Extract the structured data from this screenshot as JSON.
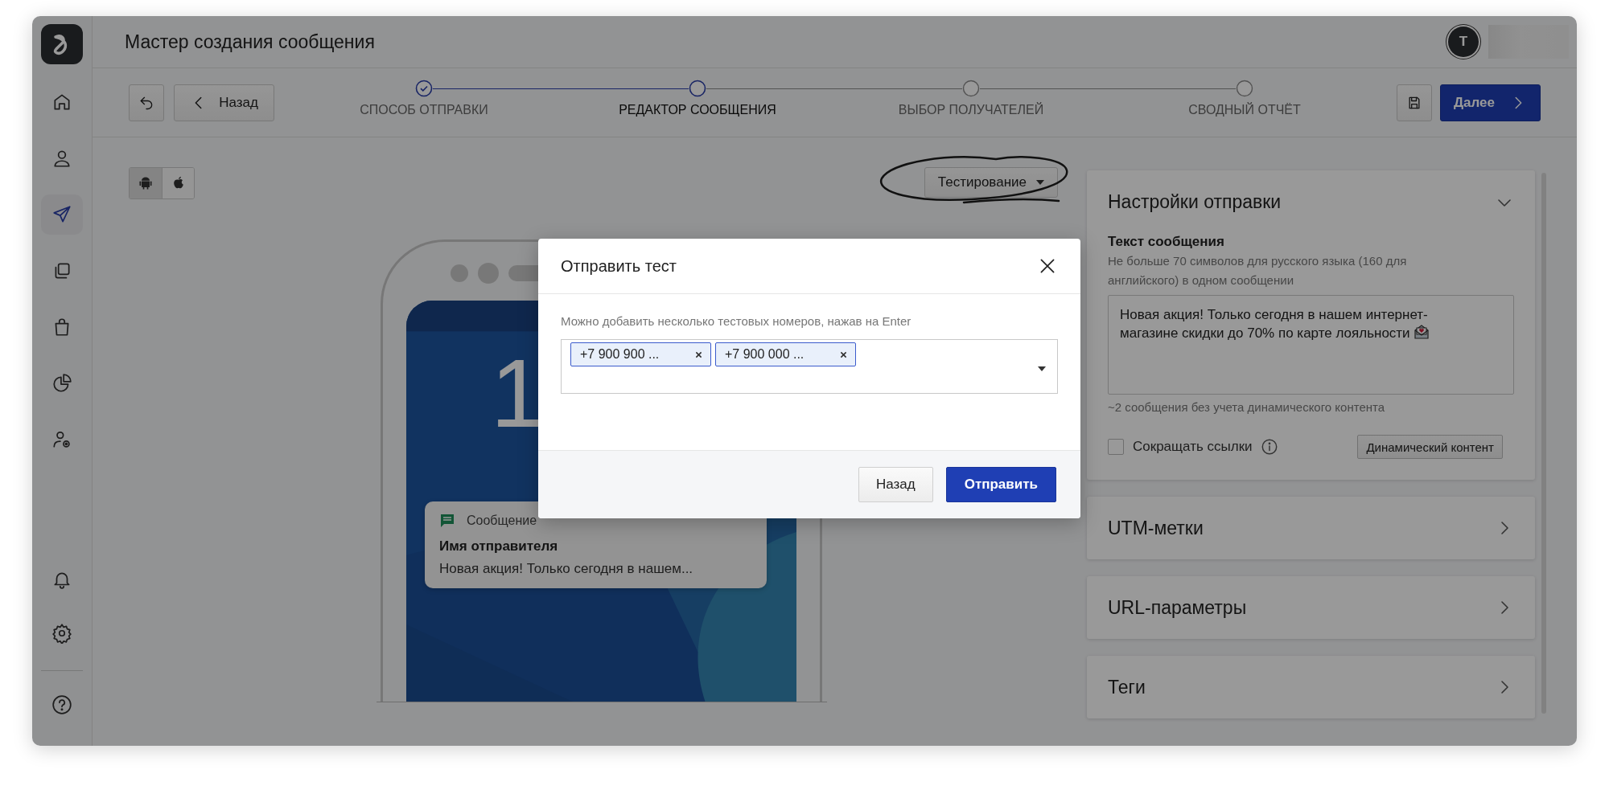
{
  "header": {
    "title": "Мастер создания сообщения",
    "avatar_initial": "T"
  },
  "sidebar": {
    "items": [
      {
        "kind": "home",
        "selected": false
      },
      {
        "kind": "user",
        "selected": false
      },
      {
        "kind": "send",
        "selected": true
      },
      {
        "kind": "copy",
        "selected": false
      },
      {
        "kind": "bag",
        "selected": false
      },
      {
        "kind": "pie",
        "selected": false
      },
      {
        "kind": "user-gear",
        "selected": false
      }
    ],
    "bottom_items": [
      {
        "kind": "bell",
        "selected": false
      },
      {
        "kind": "gear",
        "selected": false
      },
      {
        "kind": "help",
        "selected": false
      }
    ]
  },
  "toolbar": {
    "back_label": "Назад",
    "next_label": "Далее",
    "steps": [
      {
        "label": "СПОСОБ ОТПРАВКИ",
        "completed": true,
        "selected": false
      },
      {
        "label": "РЕДАКТОР СООБЩЕНИЯ",
        "completed": false,
        "selected": true
      },
      {
        "label": "ВЫБОР ПОЛУЧАТЕЛЕЙ",
        "completed": false,
        "selected": false
      },
      {
        "label": "СВОДНЫЙ ОТЧЁТ",
        "completed": false,
        "selected": false
      }
    ]
  },
  "platforms": [
    {
      "kind": "android",
      "selected": true
    },
    {
      "kind": "ios",
      "selected": false
    }
  ],
  "test_button": "Тестирование",
  "phone": {
    "clock": "1",
    "notification": {
      "app": "Сообщение",
      "sender": "Имя отправителя",
      "text": "Новая акция! Только сегодня в нашем..."
    }
  },
  "settings": {
    "title": "Настройки отправки",
    "expanded": true,
    "message_label": "Текст сообщения",
    "hint": "Не больше 70 символов для русского языка (160 для английского) в одном сообщении",
    "message": "Новая акция! Только сегодня в нашем интернет-магазине скидки до 70% по карте лояльности",
    "counter": "~2 сообщения без учета динамического контента",
    "shorten_links": {
      "label": "Сокращать ссылки",
      "checked": false
    },
    "dynamic_button": "Динамический контент"
  },
  "sections": [
    {
      "title": "UTM-метки",
      "expanded": false
    },
    {
      "title": "URL-параметры",
      "expanded": false
    },
    {
      "title": "Теги",
      "expanded": false
    }
  ],
  "modal": {
    "title": "Отправить тест",
    "hint": "Можно добавить несколько тестовых номеров, нажав на Enter",
    "chips": [
      {
        "label": "+7 900 900 ..."
      },
      {
        "label": "+7 900 000 ..."
      }
    ],
    "buttons": [
      {
        "label": "Назад",
        "kind": "secondary"
      },
      {
        "label": "Отправить",
        "kind": "primary"
      }
    ]
  }
}
